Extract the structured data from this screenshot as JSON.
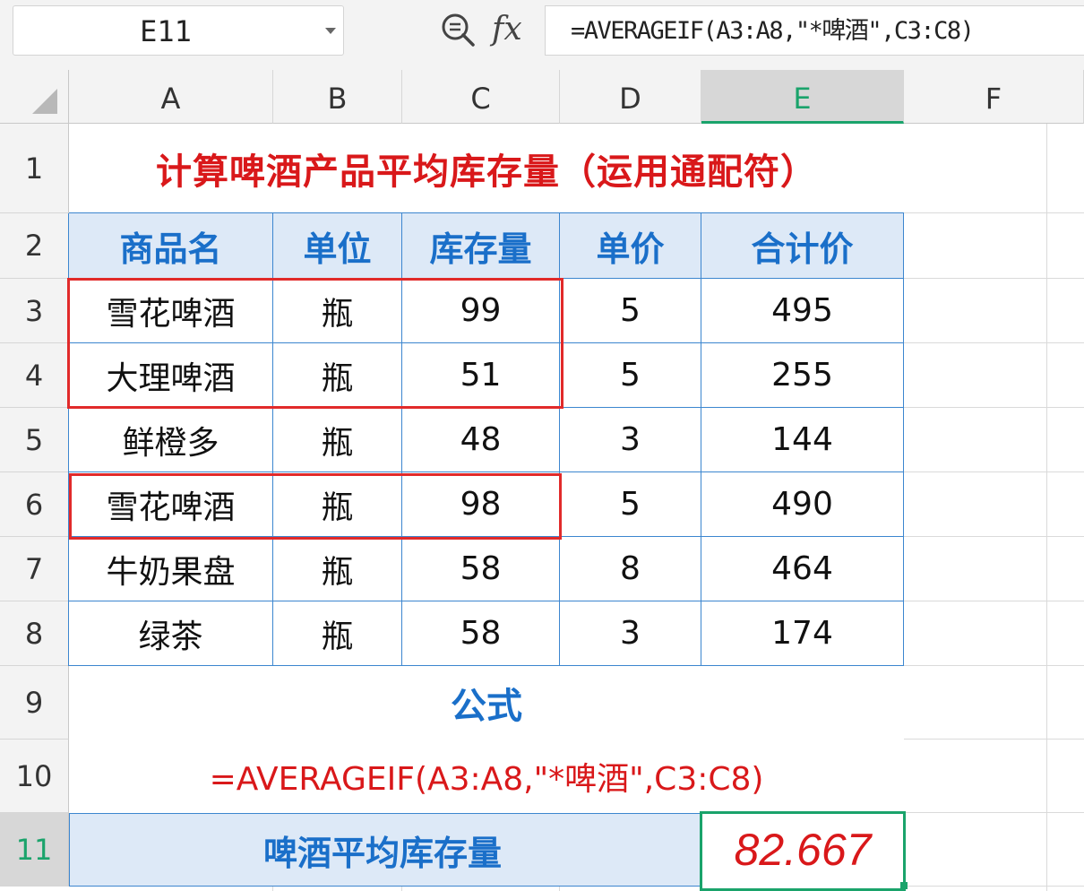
{
  "formula_bar": {
    "name_box": "E11",
    "fx_label": "fx",
    "formula": "=AVERAGEIF(A3:A8,\"*啤酒\",C3:C8)"
  },
  "grid": {
    "column_headers": [
      "A",
      "B",
      "C",
      "D",
      "E",
      "F"
    ],
    "row_headers": [
      "1",
      "2",
      "3",
      "4",
      "5",
      "6",
      "7",
      "8",
      "9",
      "10",
      "11"
    ],
    "selected_cell": "E11"
  },
  "sheet": {
    "title": "计算啤酒产品平均库存量（运用通配符）",
    "table_headers": [
      "商品名",
      "单位",
      "库存量",
      "单价",
      "合计价"
    ],
    "rows": [
      [
        "雪花啤酒",
        "瓶",
        "99",
        "5",
        "495"
      ],
      [
        "大理啤酒",
        "瓶",
        "51",
        "5",
        "255"
      ],
      [
        "鲜橙多",
        "瓶",
        "48",
        "3",
        "144"
      ],
      [
        "雪花啤酒",
        "瓶",
        "98",
        "5",
        "490"
      ],
      [
        "牛奶果盘",
        "瓶",
        "58",
        "8",
        "464"
      ],
      [
        "绿茶",
        "瓶",
        "58",
        "3",
        "174"
      ]
    ],
    "formula_label": "公式",
    "formula_display": "=AVERAGEIF(A3:A8,\"*啤酒\",C3:C8)",
    "result_label": "啤酒平均库存量",
    "result_value": "82.667"
  },
  "colors": {
    "title_red": "#d9181a",
    "header_blue": "#1a6fc9",
    "header_fill": "#dde9f7",
    "table_border": "#3c86cf",
    "selection_green": "#1aa36b",
    "highlight_red": "#e12a2a"
  },
  "icons": {
    "zoom": "zoom-formula-icon",
    "fx": "insert-function-icon",
    "dropdown": "chevron-down-icon"
  }
}
